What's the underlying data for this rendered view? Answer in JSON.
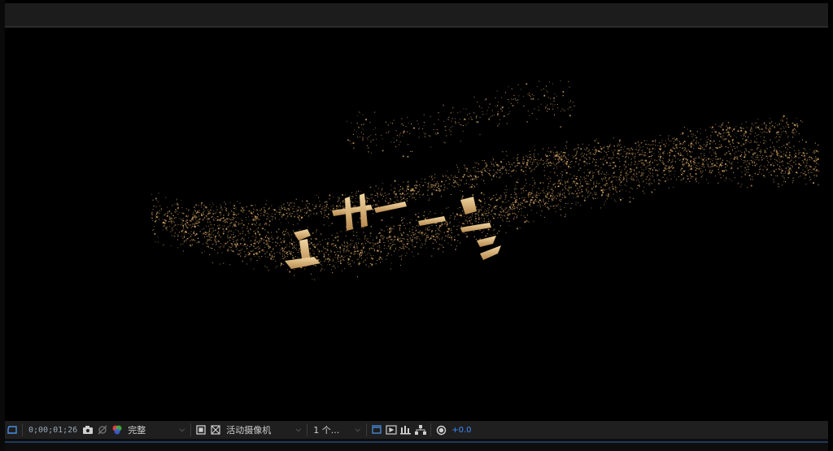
{
  "viewer": {
    "title_glyphs": [
      "上",
      "中",
      "子",
      "多"
    ]
  },
  "toolbar": {
    "timecode": "0;00;01;26",
    "resolution": "完整",
    "camera": "活动摄像机",
    "views": "1 个...",
    "exposure": "+0.0"
  },
  "colors": {
    "particle": "#d6a765",
    "accent": "#4a90e2",
    "exposure": "#3d8bff"
  }
}
